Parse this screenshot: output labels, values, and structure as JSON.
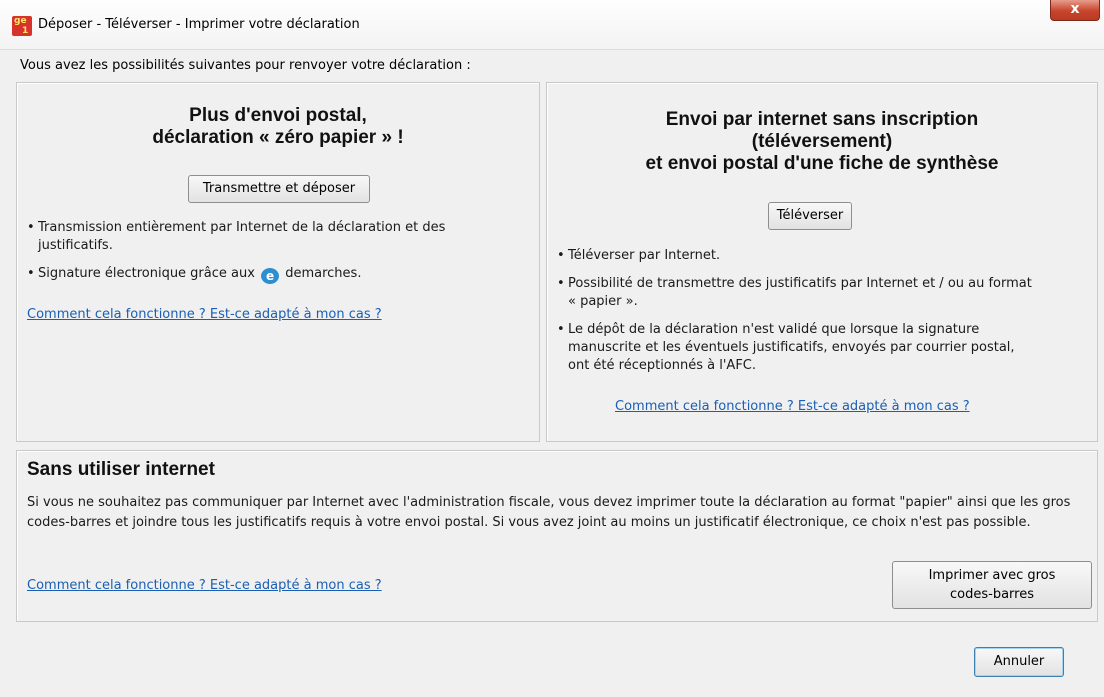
{
  "window": {
    "title": "Déposer - Téléverser - Imprimer votre déclaration",
    "close_label": "x",
    "icon_text_1": "ge",
    "icon_text_2": "1"
  },
  "intro_text": "Vous avez les possibilités suivantes pour renvoyer votre déclaration :",
  "left_panel": {
    "heading_line1": "Plus d'envoi postal,",
    "heading_line2": "déclaration « zéro papier » !",
    "button_label": "Transmettre et déposer",
    "bullets": [
      "Transmission entièrement par Internet de la déclaration et des justificatifs.",
      "Signature électronique grâce aux"
    ],
    "bullet2_suffix": "demarches.",
    "logo_glyph": "e",
    "link_text": "Comment cela fonctionne ? Est-ce adapté à mon cas ?"
  },
  "right_panel": {
    "heading_line1": "Envoi par internet sans inscription",
    "heading_line2": "(téléversement)",
    "heading_line3": "et envoi postal d'une fiche de synthèse",
    "button_label": "Téléverser",
    "bullets": [
      "Téléverser par Internet.",
      "Possibilité de transmettre des justificatifs par Internet et / ou au format « papier ».",
      "Le dépôt de la déclaration n'est validé que lorsque la signature manuscrite et les éventuels justificatifs, envoyés par courrier postal, ont été réceptionnés à l'AFC."
    ],
    "link_text": "Comment cela fonctionne ? Est-ce adapté à mon cas ?"
  },
  "bottom_panel": {
    "title": "Sans utiliser internet",
    "text": "Si vous ne souhaitez pas communiquer par Internet avec l'administration fiscale, vous devez imprimer toute la déclaration au format \"papier\" ainsi que les gros codes-barres et joindre tous les justificatifs requis à votre envoi postal. Si vous avez joint au moins un justificatif électronique, ce choix n'est pas possible.",
    "link_text": "Comment cela fonctionne ? Est-ce adapté à mon cas ?",
    "button_line1": "Imprimer avec gros",
    "button_line2": "codes-barres"
  },
  "cancel_label": "Annuler",
  "colors": {
    "link": "#1a5fb4",
    "close_button": "#c8442c",
    "background": "#f0f0f0"
  }
}
